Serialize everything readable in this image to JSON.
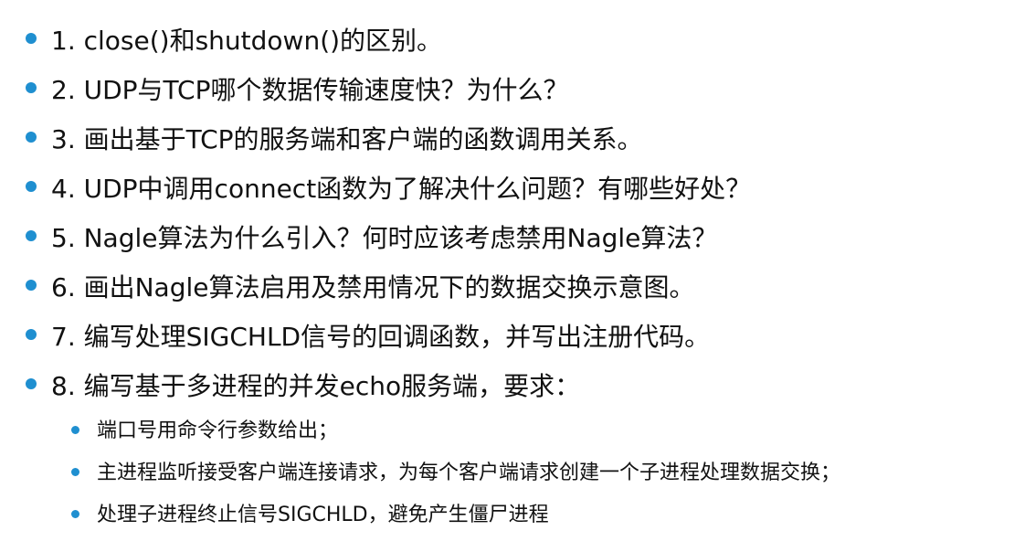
{
  "items": [
    {
      "text": "1. close()和shutdown()的区别。"
    },
    {
      "text": "2. UDP与TCP哪个数据传输速度快？为什么？"
    },
    {
      "text": "3. 画出基于TCP的服务端和客户端的函数调用关系。"
    },
    {
      "text": "4. UDP中调用connect函数为了解决什么问题？有哪些好处？"
    },
    {
      "text": "5. Nagle算法为什么引入？何时应该考虑禁用Nagle算法？"
    },
    {
      "text": "6. 画出Nagle算法启用及禁用情况下的数据交换示意图。"
    },
    {
      "text": "7. 编写处理SIGCHLD信号的回调函数，并写出注册代码。"
    },
    {
      "text": "8. 编写基于多进程的并发echo服务端，要求："
    }
  ],
  "subitems": [
    {
      "text": "端口号用命令行参数给出；"
    },
    {
      "text": "主进程监听接受客户端连接请求，为每个客户端请求创建一个子进程处理数据交换；"
    },
    {
      "text": "处理子进程终止信号SIGCHLD，避免产生僵尸进程"
    }
  ],
  "colors": {
    "bullet": "#1f8fd0",
    "text": "#111111",
    "background": "#ffffff"
  }
}
